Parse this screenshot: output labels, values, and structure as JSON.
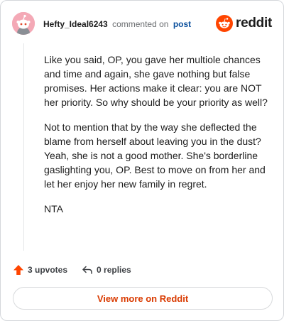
{
  "header": {
    "username": "Hefty_Ideal6243",
    "action_text": "commented on",
    "post_link": "post",
    "brand": "reddit"
  },
  "comment": {
    "paragraphs": [
      "Like you said, OP, you gave her multiole chances and time and again, she gave nothing but false promises. Her actions make it clear: you are NOT her priority. So why should be your priority as well?",
      "Not to mention that by the way she deflected the blame from herself about leaving you in the dust? Yeah, she is not a good mother. She's borderline gaslighting you, OP. Best to move on from her and let her enjoy her new family in regret.",
      "NTA"
    ]
  },
  "actions": {
    "upvotes_label": "3 upvotes",
    "replies_label": "0 replies"
  },
  "footer": {
    "view_more_label": "View more on Reddit"
  },
  "icons": {
    "avatar": "snoo-avatar-icon",
    "brand": "reddit-logo-icon",
    "upvote": "upvote-arrow-icon",
    "reply": "reply-arrow-icon"
  },
  "colors": {
    "brand_orange": "#ff4500",
    "link_blue": "#0a4f9c",
    "cta_red": "#d93a00",
    "avatar_pink": "#f4a9b6"
  }
}
